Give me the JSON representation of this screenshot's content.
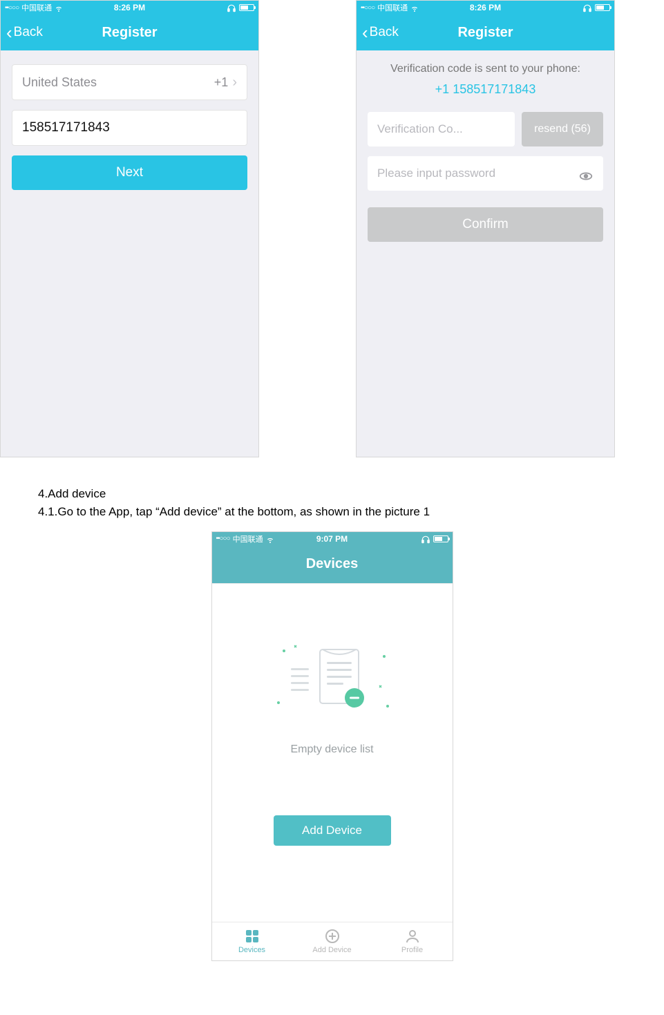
{
  "screen1": {
    "status": {
      "carrier": "中国联通",
      "time": "8:26 PM",
      "dots": "••○○○"
    },
    "nav": {
      "back": "Back",
      "title": "Register"
    },
    "country_row": {
      "name": "United States",
      "dial": "+1"
    },
    "phone_value": "158517171843",
    "next_label": "Next"
  },
  "screen2": {
    "status": {
      "carrier": "中国联通",
      "time": "8:26 PM",
      "dots": "••○○○"
    },
    "nav": {
      "back": "Back",
      "title": "Register"
    },
    "sent_text": "Verification code is sent to your phone:",
    "sent_phone": "+1 158517171843",
    "code_placeholder": "Verification Co...",
    "resend_label": "resend (56)",
    "password_placeholder": "Please input password",
    "confirm_label": "Confirm"
  },
  "doc": {
    "line1": "4.Add device",
    "line2_a": "4.1.Go to the App, tap ",
    "line2_b": "“Add device”",
    "line2_c": " at the bottom, as shown in the picture 1"
  },
  "screen3": {
    "status": {
      "carrier": "中国联通",
      "time": "9:07 PM",
      "dots": "••○○○"
    },
    "title": "Devices",
    "empty_label": "Empty device list",
    "add_button": "Add Device",
    "tabs": {
      "devices": "Devices",
      "add": "Add Device",
      "profile": "Profile"
    }
  },
  "colors": {
    "brand1": "#29c4e4",
    "brand2": "#5ab7c0",
    "disabled": "#c9cacb"
  }
}
